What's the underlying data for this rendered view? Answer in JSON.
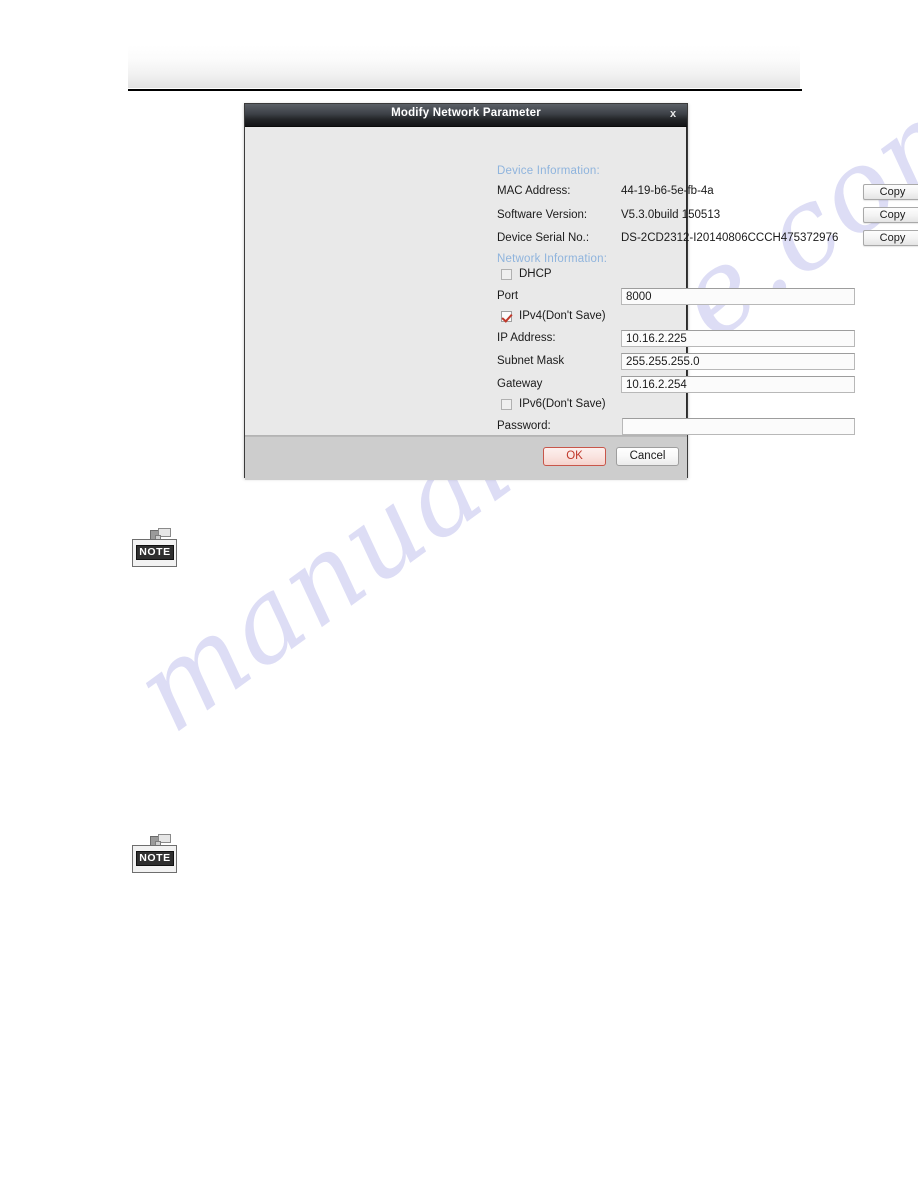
{
  "watermark": {
    "text": "manualshive.com"
  },
  "dialog": {
    "title": "Modify Network Parameter",
    "close_label": "x",
    "sections": {
      "device_information": "Device Information:",
      "network_information": "Network Information:"
    },
    "device_rows": [
      {
        "label": "MAC Address:",
        "value": "44-19-b6-5e-fb-4a",
        "button": "Copy"
      },
      {
        "label": "Software Version:",
        "value": "V5.3.0build 150513",
        "button": "Copy"
      },
      {
        "label": "Device Serial No.:",
        "value": "DS-2CD2312-I20140806CCCH475372976",
        "button": "Copy"
      }
    ],
    "network": {
      "dhcp": {
        "label": "DHCP",
        "checked": false
      },
      "port": {
        "label": "Port",
        "value": "8000"
      },
      "ipv4": {
        "label": "IPv4(Don't Save)",
        "checked": true
      },
      "ip_address": {
        "label": "IP Address:",
        "value": "10.16.2.225"
      },
      "subnet_mask": {
        "label": "Subnet Mask",
        "value": "255.255.255.0"
      },
      "gateway": {
        "label": "Gateway",
        "value": "10.16.2.254"
      },
      "ipv6": {
        "label": "IPv6(Don't Save)",
        "checked": false
      },
      "password": {
        "label": "Password:",
        "value": ""
      }
    },
    "footer": {
      "ok_label": "OK",
      "cancel_label": "Cancel"
    }
  },
  "notes": [
    {
      "badge": "NOTE"
    },
    {
      "badge": "NOTE"
    }
  ],
  "colors": {
    "section_header": "#8fb4dd",
    "ok_accent": "#c0392b",
    "titlebar_dark": "#232528",
    "watermark": "#c9c9ef"
  }
}
